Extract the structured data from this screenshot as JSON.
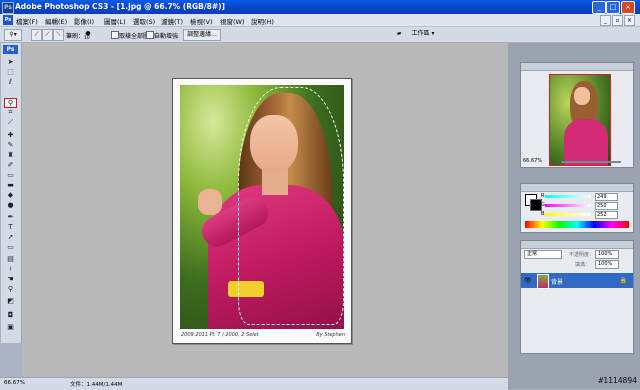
{
  "window": {
    "title": "Adobe Photoshop CS3 - [1.jpg @ 66.7% (RGB/8#)]",
    "app_icon": "Ps"
  },
  "menu": {
    "items": [
      "檔案(F)",
      "編輯(E)",
      "影像(I)",
      "圖層(L)",
      "選取(S)",
      "濾鏡(T)",
      "檢視(V)",
      "視窗(W)",
      "說明(H)"
    ]
  },
  "options": {
    "brush_label": "筆刷：",
    "brush_size": "10",
    "sample_all": "取樣全部圖層",
    "auto_enhance": "自動增強",
    "refine_edge": "調整邊緣...",
    "workspace": "工作區 ▾"
  },
  "toolbox": {
    "logo": "Ps"
  },
  "document": {
    "caption": "2009 2011 Pl: 7 / 2000, 2 Selet",
    "signature": "By Stephen"
  },
  "status": {
    "zoom": "66.67%",
    "doc_info": "文件：1.44M/1.44M"
  },
  "navigator": {
    "zoom": "66.67%"
  },
  "color": {
    "r_label": "R",
    "r_value": "249",
    "g_label": "G",
    "g_value": "250",
    "b_label": "B",
    "b_value": "252"
  },
  "layers": {
    "blend_mode": "正常",
    "opacity_label": "不透明度：",
    "opacity": "100%",
    "fill_label": "填滿：",
    "fill": "100%",
    "layer_name": "背景"
  },
  "watermark": "#1114894"
}
